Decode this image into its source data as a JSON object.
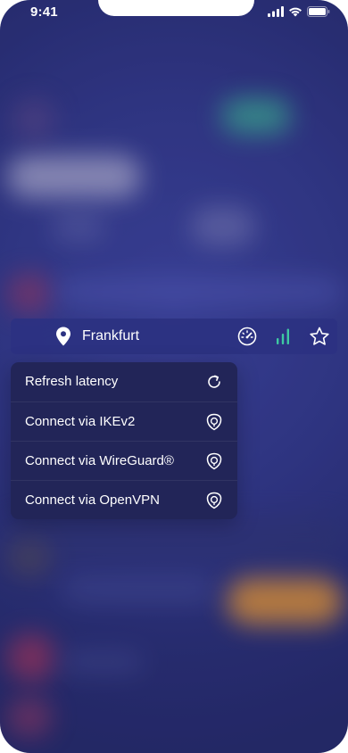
{
  "status_bar": {
    "time": "9:41"
  },
  "location": {
    "name": "Frankfurt"
  },
  "menu": {
    "items": [
      {
        "label": "Refresh latency",
        "icon": "refresh-icon"
      },
      {
        "label": "Connect via IKEv2",
        "icon": "shield-icon"
      },
      {
        "label": "Connect via WireGuard®",
        "icon": "shield-icon"
      },
      {
        "label": "Connect via OpenVPN",
        "icon": "shield-icon"
      }
    ]
  },
  "colors": {
    "background": "#343b8d",
    "card": "#2c3282",
    "menu": "#222558",
    "signal": "#3ec9a2"
  }
}
